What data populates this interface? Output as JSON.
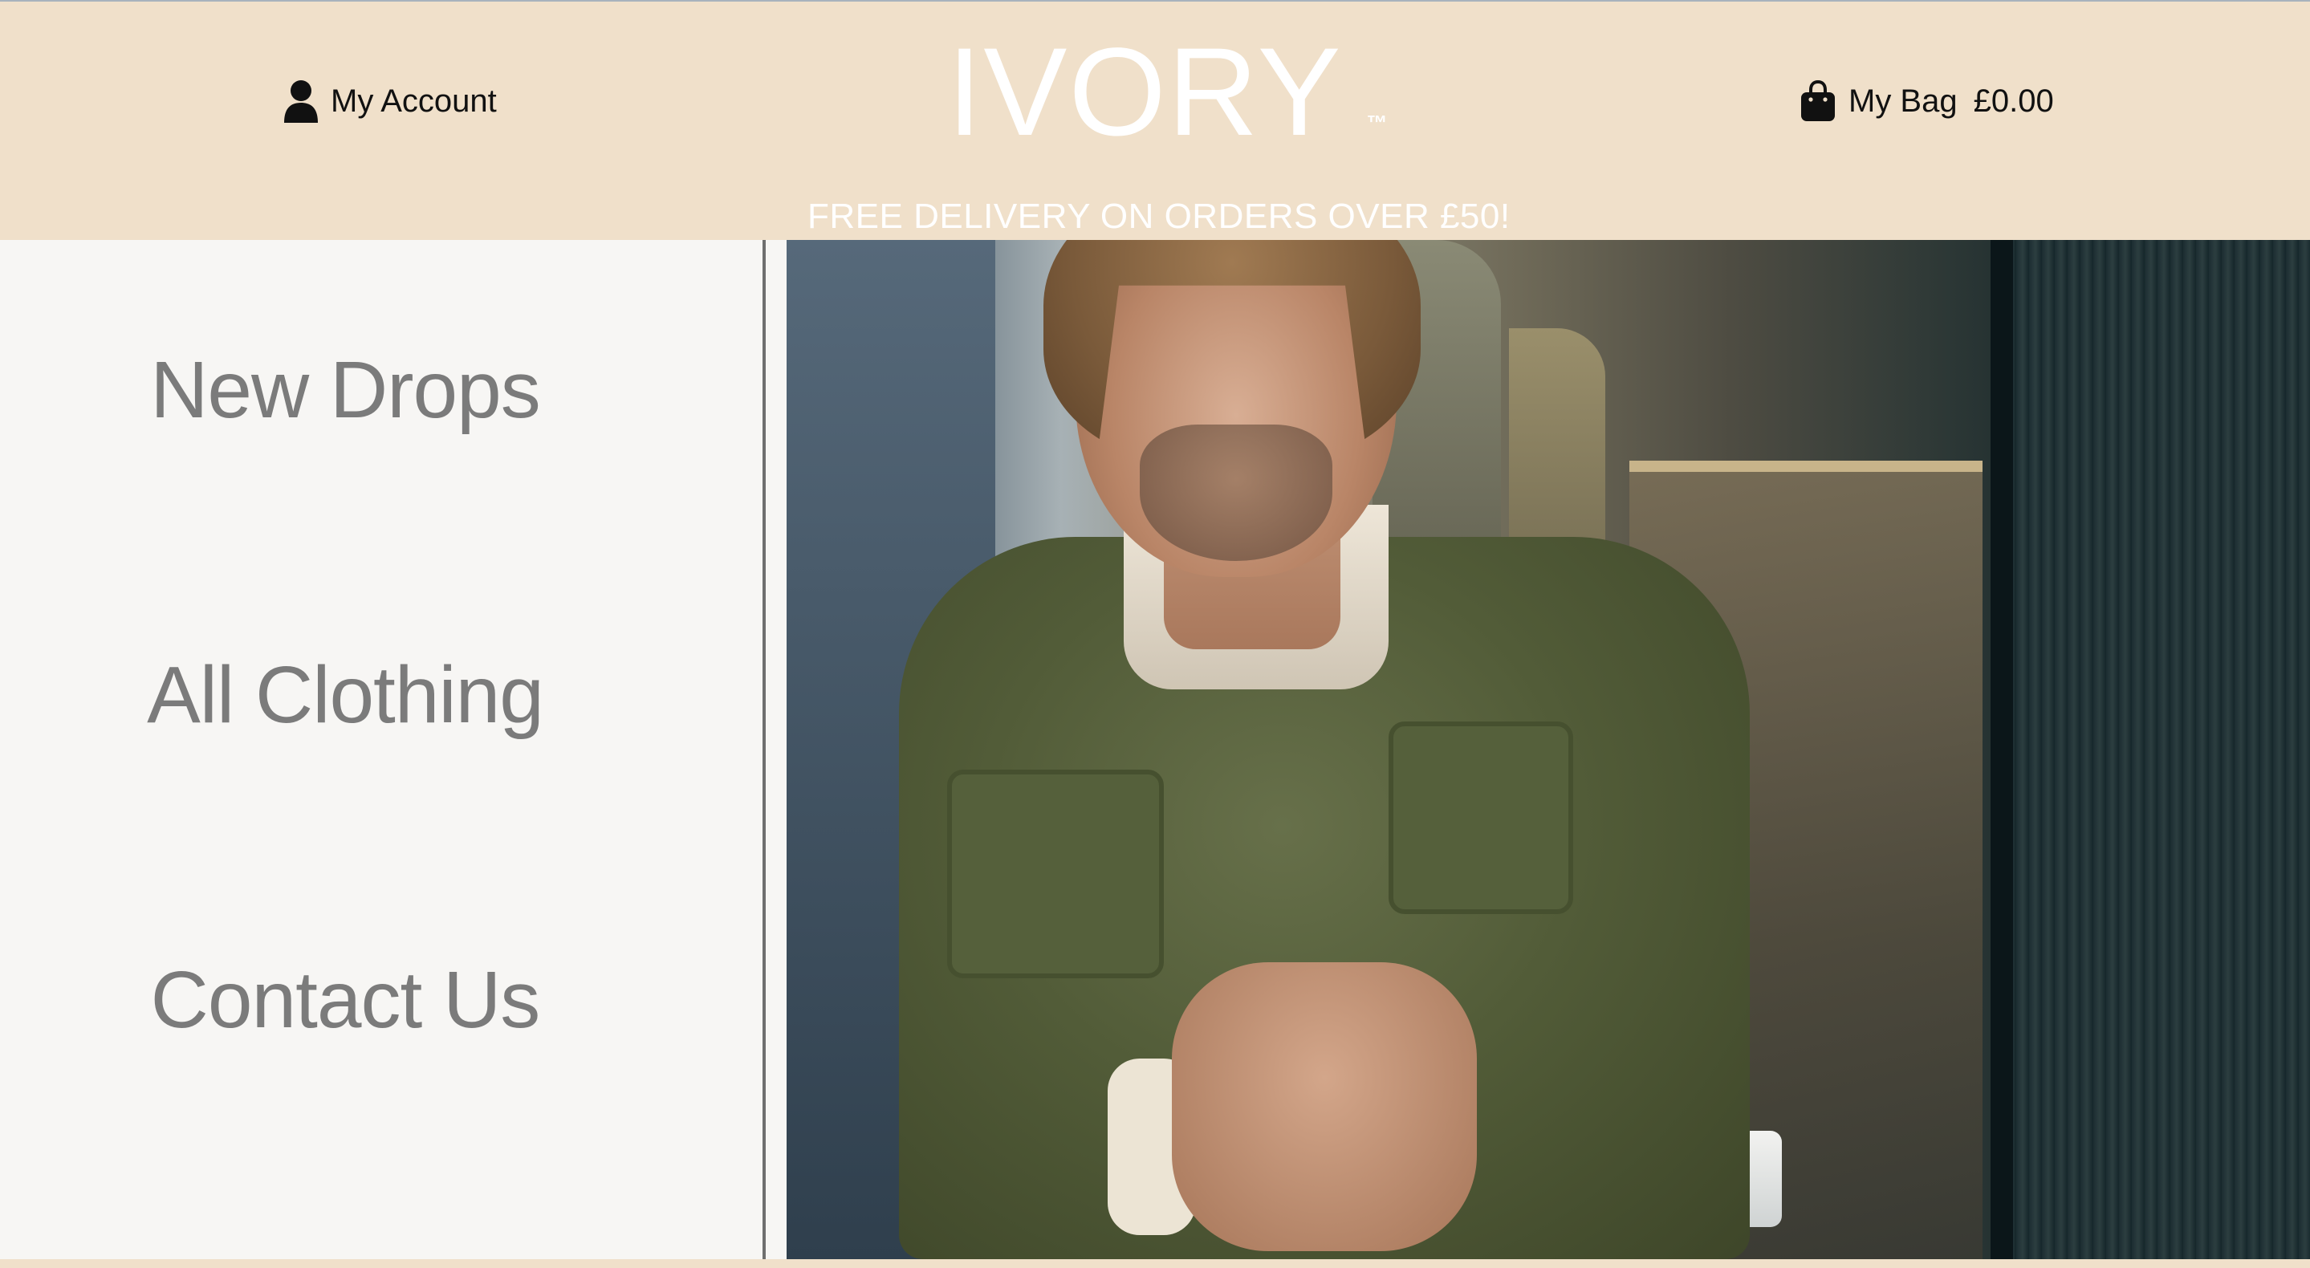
{
  "header": {
    "account_label": "My Account",
    "brand_name": "IVORY",
    "brand_tm": "™",
    "bag_label": "My Bag",
    "bag_total": "£0.00",
    "promo_text": "FREE DELIVERY ON ORDERS OVER £50!"
  },
  "nav": {
    "items": [
      {
        "label": "New Drops"
      },
      {
        "label": "All Clothing"
      },
      {
        "label": "Contact Us"
      }
    ]
  },
  "hero": {
    "image_description": "Man with shoulder-length hair wearing an olive green button-up shirt over a cream henley, buttoning his cuff, standing in a modern bathroom"
  },
  "colors": {
    "header_bg": "#f0e0ca",
    "sidebar_bg": "#f7f6f4",
    "nav_text": "#7b7b7b",
    "brand_text": "#ffffff"
  },
  "icons": {
    "account": "user-icon",
    "bag": "shopping-bag-icon"
  }
}
